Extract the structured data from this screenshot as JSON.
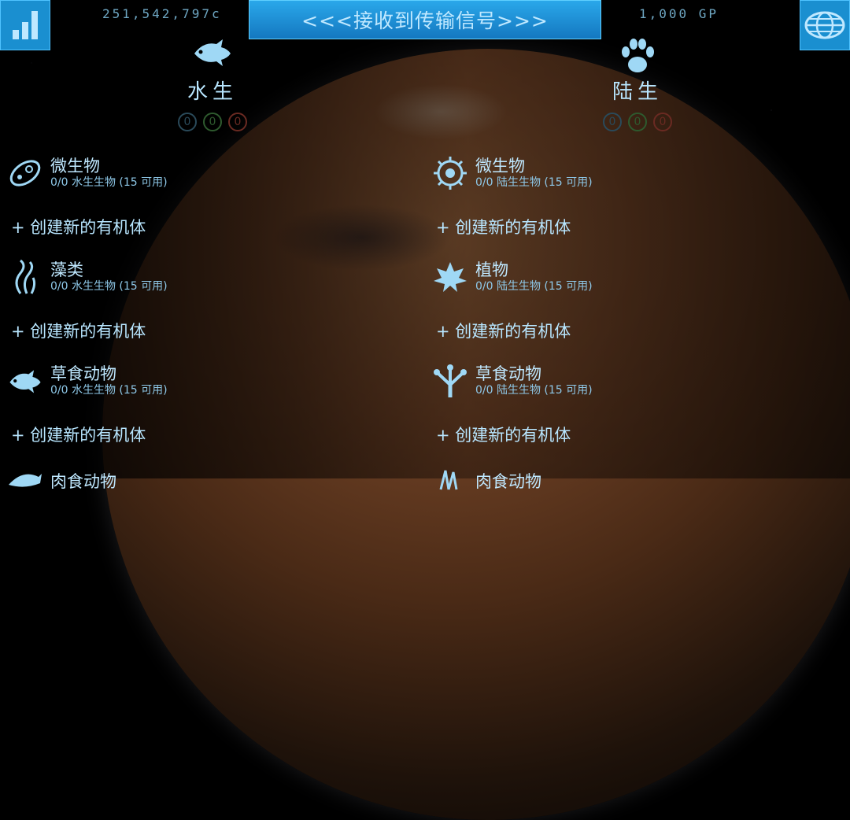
{
  "top": {
    "credits": "251,542,797c",
    "banner": "<<<接收到传输信号>>>",
    "gp": "1,000 GP"
  },
  "aquatic": {
    "title": "水生",
    "counters": [
      "0",
      "0",
      "0"
    ],
    "categories": [
      {
        "name": "微生物",
        "sub": "0/0 水生生物 (15 可用)",
        "icon": "paramecium-icon"
      },
      {
        "name": "藻类",
        "sub": "0/0 水生生物 (15 可用)",
        "icon": "seaweed-icon"
      },
      {
        "name": "草食动物",
        "sub": "0/0 水生生物 (15 可用)",
        "icon": "fish-icon"
      },
      {
        "name": "肉食动物",
        "sub": "",
        "icon": "shark-icon"
      }
    ]
  },
  "terrestrial": {
    "title": "陆生",
    "counters": [
      "0",
      "0",
      "0"
    ],
    "categories": [
      {
        "name": "微生物",
        "sub": "0/0 陆生生物 (15 可用)",
        "icon": "virus-icon"
      },
      {
        "name": "植物",
        "sub": "0/0 陆生生物 (15 可用)",
        "icon": "leaf-icon"
      },
      {
        "name": "草食动物",
        "sub": "0/0 陆生生物 (15 可用)",
        "icon": "frog-foot-icon"
      },
      {
        "name": "肉食动物",
        "sub": "",
        "icon": "claw-icon"
      }
    ]
  },
  "create_label": "+ 创建新的有机体",
  "colors": {
    "accent": "#1a8fd0",
    "text": "#bfe8ff"
  }
}
